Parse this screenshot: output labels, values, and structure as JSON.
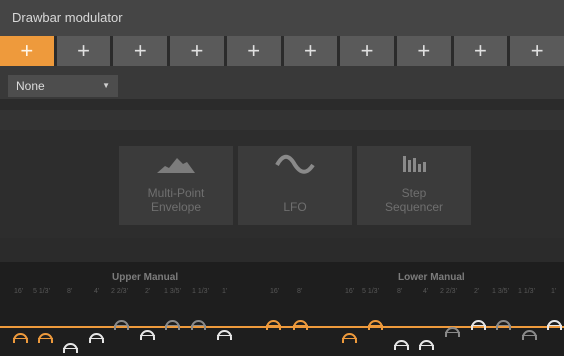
{
  "header": {
    "title": "Drawbar modulator"
  },
  "slots": [
    "+",
    "+",
    "+",
    "+",
    "+",
    "+",
    "+",
    "+",
    "+",
    "+"
  ],
  "source_select": {
    "value": "None",
    "arrow": "▼"
  },
  "cards": [
    {
      "name": "multi-point-envelope",
      "lines": [
        "Multi-Point",
        "Envelope"
      ],
      "icon": "envelope-icon"
    },
    {
      "name": "lfo",
      "lines": [
        "LFO"
      ],
      "icon": "sine-wave-icon"
    },
    {
      "name": "step-sequencer",
      "lines": [
        "Step",
        "Sequencer"
      ],
      "icon": "bars-icon"
    }
  ],
  "manuals": {
    "upper": "Upper Manual",
    "lower": "Lower Manual"
  },
  "footages": {
    "upper": [
      "16'",
      "5 1/3'",
      "8'",
      "4'",
      "2 2/3'",
      "2'",
      "1 3/5'",
      "1 1/3'",
      "1'"
    ],
    "pedal": [
      "16'",
      "8'"
    ],
    "lower": [
      "16'",
      "5 1/3'",
      "8'",
      "4'",
      "2 2/3'",
      "2'",
      "1 3/5'",
      "1 1/3'",
      "1'"
    ]
  },
  "colors": {
    "accent": "#ee9a3c",
    "white": "#e6e6e6",
    "muted": "#8a8a8a"
  }
}
